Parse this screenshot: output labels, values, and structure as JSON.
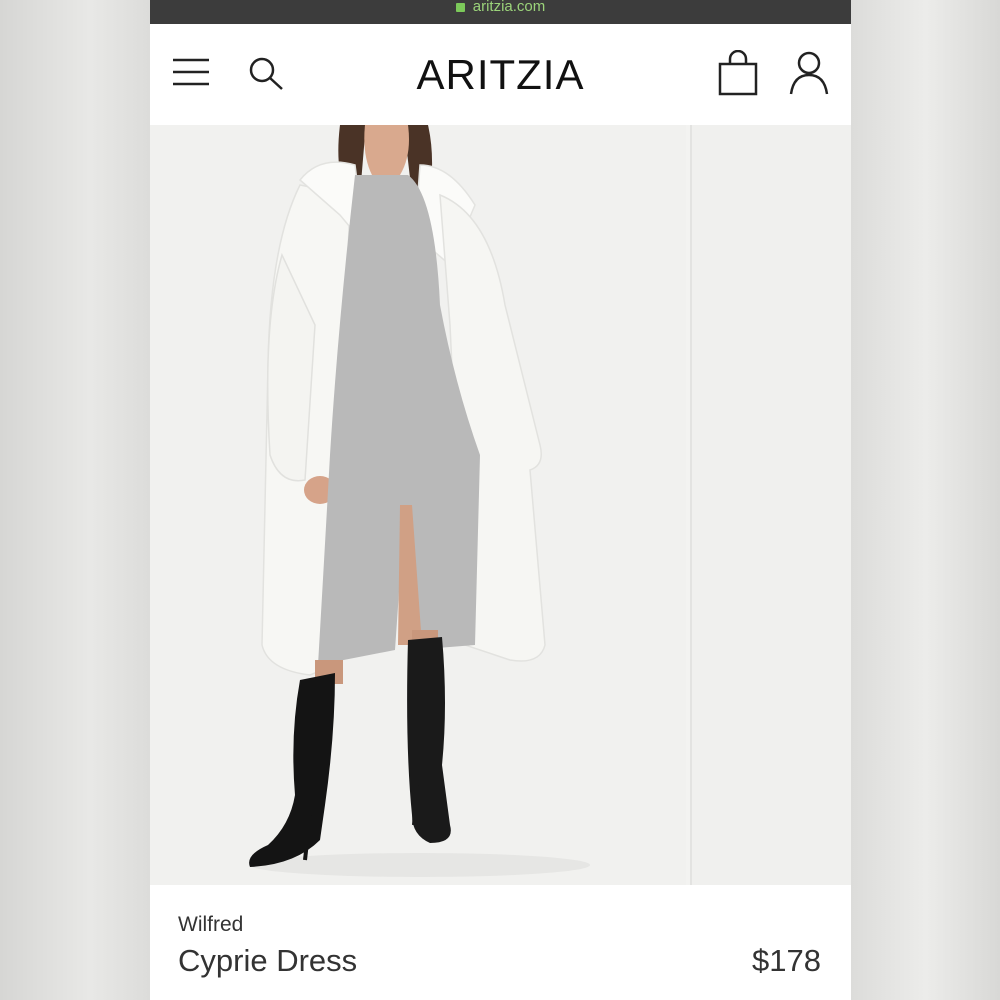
{
  "browser": {
    "url": "aritzia.com"
  },
  "header": {
    "logo": "ARITZIA",
    "icons": [
      "menu-icon",
      "search-icon",
      "shopping-bag-icon",
      "account-icon"
    ]
  },
  "product": {
    "brand": "Wilfred",
    "name": "Cyprie Dress",
    "price": "$178"
  },
  "colors": {
    "url_text": "#9bd37a",
    "url_bar": "#3c3c3c",
    "dress_grey": "#b9b9b9",
    "coat_white": "#f7f7f4",
    "boots_black": "#141414"
  }
}
